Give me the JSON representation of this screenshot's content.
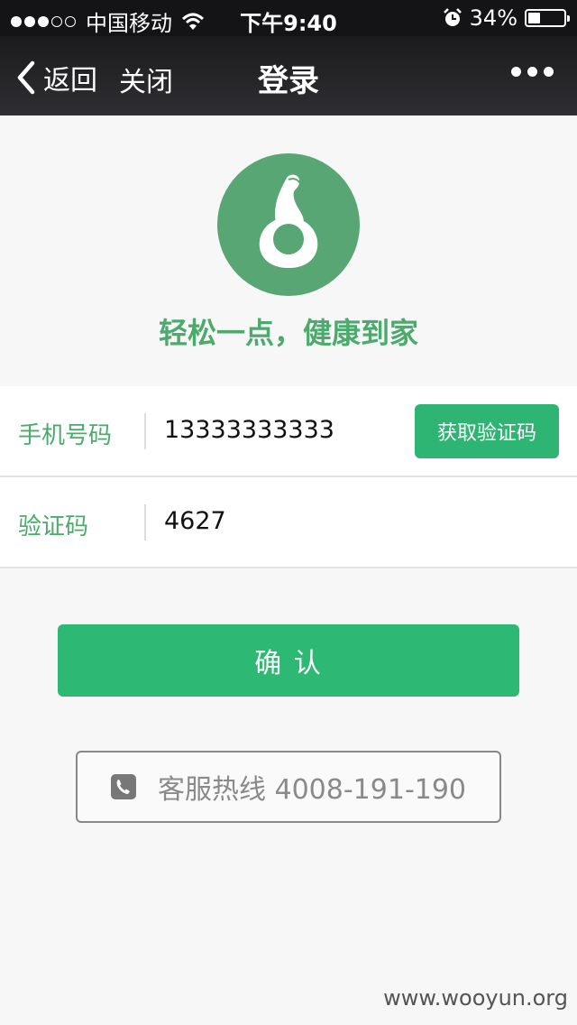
{
  "status_bar": {
    "signal_dots_filled": 3,
    "signal_dots_total": 5,
    "carrier": "中国移动",
    "time": "下午9:40",
    "battery": "34%",
    "battery_level": 0.34
  },
  "navbar": {
    "back_label": "返回",
    "close_label": "关闭",
    "title": "登录"
  },
  "brand": {
    "slogan": "轻松一点，健康到家",
    "color": "#4caa6c"
  },
  "form": {
    "phone_label": "手机号码",
    "phone_value": "13333333333",
    "get_code_label": "获取验证码",
    "code_label": "验证码",
    "code_value": "4627"
  },
  "confirm_label": "确 认",
  "hotline_label": "客服热线 4008-191-190",
  "watermark": "www.wooyun.org",
  "colors": {
    "accent": "#2db874",
    "statusbar_bg": "#141416"
  },
  "icons": [
    "wifi-icon",
    "alarm-icon",
    "battery-icon",
    "back-chevron-icon",
    "more-icon",
    "logo-icon",
    "phone-icon"
  ]
}
